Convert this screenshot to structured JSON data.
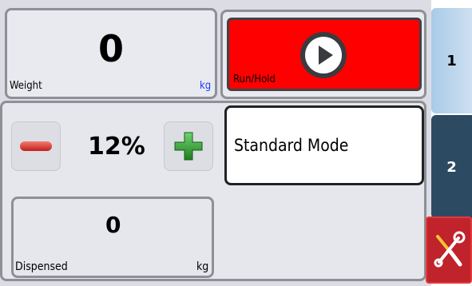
{
  "weight": {
    "value": "0",
    "label": "Weight",
    "unit": "kg"
  },
  "run": {
    "label": "Run/Hold"
  },
  "speed": {
    "percent": "12%"
  },
  "mode": {
    "label": "Standard Mode"
  },
  "dispensed": {
    "value": "0",
    "label": "Dispensed",
    "unit": "kg"
  },
  "tabs": [
    {
      "label": "1"
    },
    {
      "label": "2"
    }
  ],
  "icons": {
    "play": "play-icon",
    "minus": "minus-icon",
    "plus": "plus-icon",
    "tools": "tools-icon"
  },
  "colors": {
    "run_bg": "#ff0000",
    "tab1": "#b7d4ec",
    "tab2": "#2d4a63",
    "tools_bg": "#c0232b",
    "unit_blue": "#1a3cff",
    "plus_green": "#2f9e2f",
    "minus_red": "#e0362d"
  }
}
